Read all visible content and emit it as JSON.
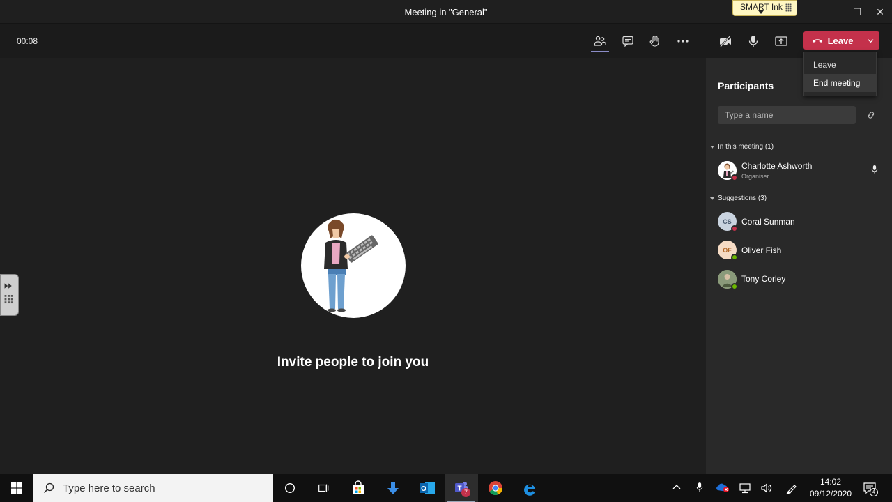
{
  "window": {
    "title": "Meeting in \"General\"",
    "minimize": "—",
    "maximize": "☐",
    "close": "✕"
  },
  "smart_ink": {
    "label": "SMART Ink"
  },
  "controls": {
    "timer": "00:08",
    "leave_label": "Leave"
  },
  "leave_menu": {
    "items": [
      "Leave",
      "End meeting"
    ]
  },
  "stage": {
    "invite_text": "Invite people to join you"
  },
  "panel": {
    "title": "Participants",
    "search_placeholder": "Type a name",
    "in_meeting_header": "In this meeting (1)",
    "suggestions_header": "Suggestions (3)",
    "in_meeting": [
      {
        "name": "Charlotte Ashworth",
        "role": "Organiser",
        "status_color": "#c4314b"
      }
    ],
    "suggestions": [
      {
        "name": "Coral Sunman",
        "initials": "CS",
        "avatar_bg": "#c9d3df",
        "avatar_fg": "#4a5b70",
        "status_color": "#c4314b"
      },
      {
        "name": "Oliver Fish",
        "initials": "OF",
        "avatar_bg": "#f6dcc5",
        "avatar_fg": "#b36a2a",
        "status_color": "#6bb700"
      },
      {
        "name": "Tony Corley",
        "initials": "",
        "avatar_bg": "#7a8a6a",
        "avatar_fg": "#fff",
        "status_color": "#6bb700"
      }
    ]
  },
  "taskbar": {
    "search_placeholder": "Type here to search",
    "teams_badge": "7",
    "time": "14:02",
    "date": "09/12/2020",
    "notification_count": "4"
  },
  "colors": {
    "accent_red": "#c4314b",
    "accent_purple": "#8b8cc7"
  }
}
